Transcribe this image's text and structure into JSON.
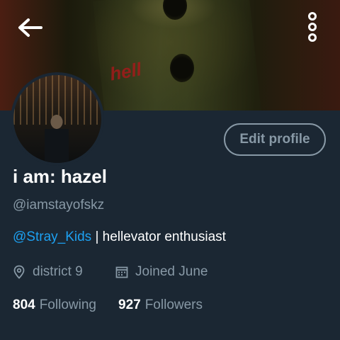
{
  "colors": {
    "background": "#1b2733",
    "secondary_text": "#8899a6",
    "primary_text": "#ffffff",
    "link": "#1da1f2"
  },
  "header": {
    "back_icon": "back-arrow-icon",
    "menu_icon": "more-vertical-icon"
  },
  "banner": {
    "overlay_text": "hell"
  },
  "profile": {
    "edit_label": "Edit profile",
    "display_name": "i am: hazel",
    "handle": "@iamstayofskz",
    "bio_mention": "@Stray_Kids",
    "bio_text": " | hellevator enthusiast",
    "location": "district 9",
    "location_icon": "location-pin-icon",
    "joined": "Joined June",
    "joined_icon": "calendar-icon",
    "following_count": "804",
    "following_label": "Following",
    "followers_count": "927",
    "followers_label": "Followers"
  }
}
